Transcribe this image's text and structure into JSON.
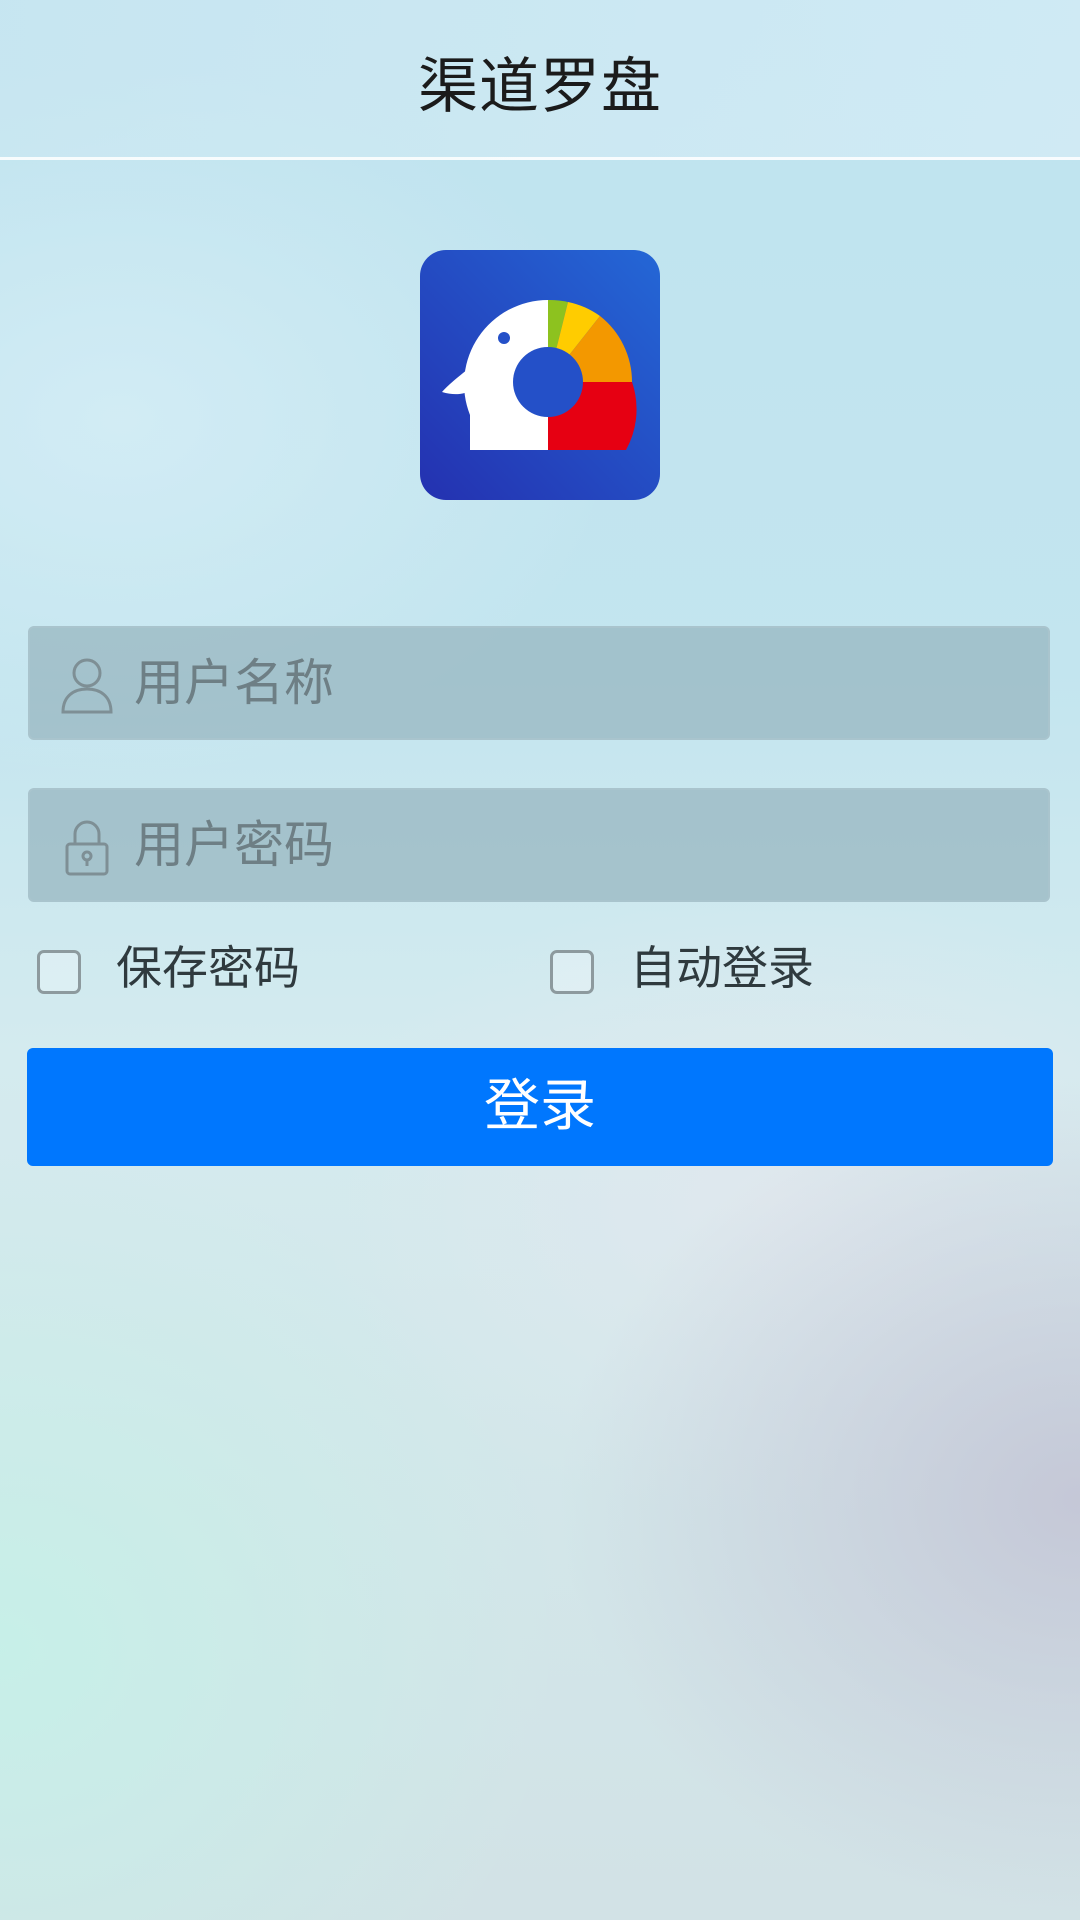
{
  "header": {
    "title": "渠道罗盘"
  },
  "logo": {
    "icon": "elephant-pie-chart-logo",
    "colors": {
      "background": "#2450c8",
      "green": "#8dc21f",
      "yellow": "#ffcc00",
      "orange": "#f39800",
      "red": "#e60012",
      "white": "#ffffff"
    }
  },
  "login_form": {
    "username": {
      "icon": "user-icon",
      "placeholder": "用户名称",
      "value": ""
    },
    "password": {
      "icon": "lock-icon",
      "placeholder": "用户密码",
      "value": ""
    },
    "save_password": {
      "label": "保存密码",
      "checked": false
    },
    "auto_login": {
      "label": "自动登录",
      "checked": false
    },
    "submit_label": "登录"
  },
  "colors": {
    "accent": "#0077fe",
    "text_dark": "#1b1b1b",
    "input_bg": "#a0b9c1"
  }
}
